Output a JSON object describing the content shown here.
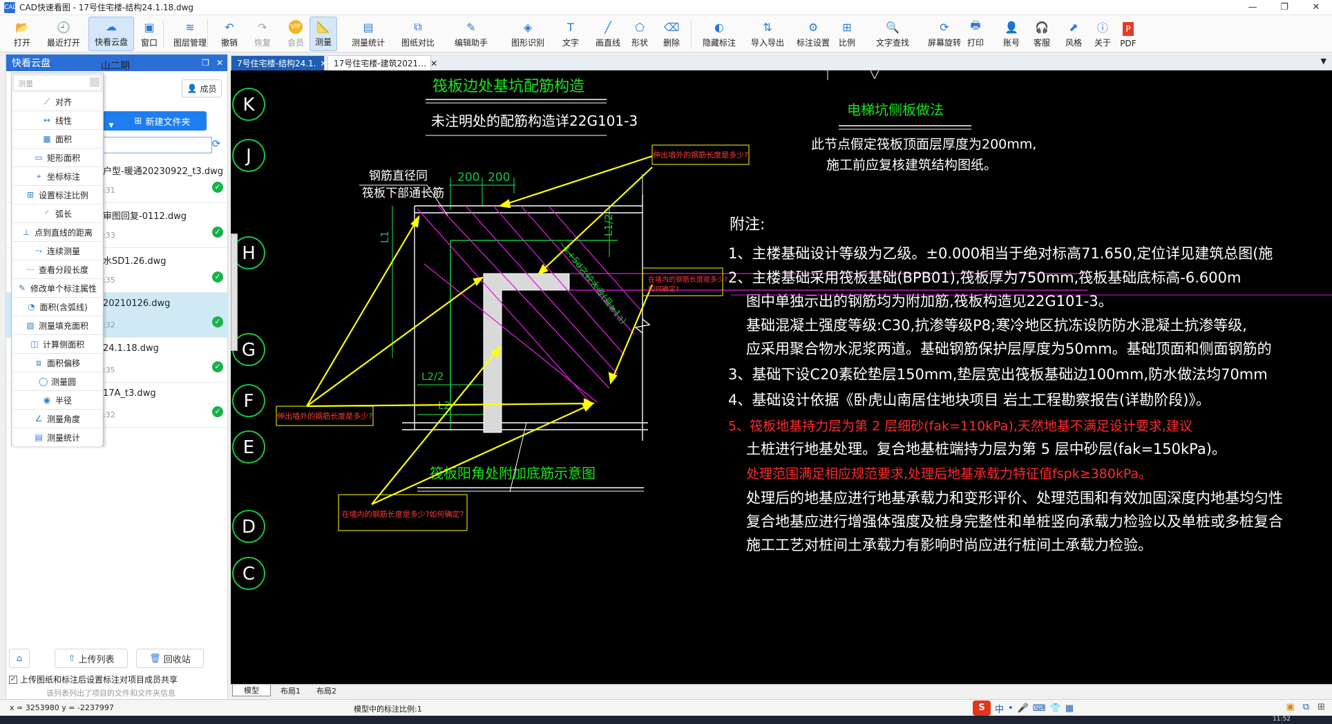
{
  "window": {
    "app_icon": "CAD",
    "title": "CAD快速看图 - 17号住宅楼-结构24.1.18.dwg",
    "controls": [
      "—",
      "❐",
      "✕"
    ]
  },
  "toolbar": {
    "buttons": [
      {
        "label": "打开",
        "icon": "open-folder-icon",
        "glyph": "📂"
      },
      {
        "label": "最近打开",
        "icon": "clock-icon",
        "glyph": "🕘"
      },
      {
        "label": "快看云盘",
        "icon": "cloud-icon",
        "glyph": "☁"
      },
      {
        "label": "窗口",
        "icon": "window-icon",
        "glyph": "▣"
      },
      {
        "label": "图层管理",
        "icon": "layers-icon",
        "glyph": "≋"
      },
      {
        "label": "撤销",
        "icon": "undo-icon",
        "glyph": "↶"
      },
      {
        "label": "恢复",
        "icon": "redo-icon",
        "glyph": "↷"
      },
      {
        "label": "会员",
        "icon": "vip-icon",
        "glyph": "VIP"
      },
      {
        "label": "测量",
        "icon": "measure-icon",
        "glyph": "📐"
      },
      {
        "label": "测量统计",
        "icon": "measure-stats-icon",
        "glyph": "▤"
      },
      {
        "label": "图纸对比",
        "icon": "compare-icon",
        "glyph": "⧉"
      },
      {
        "label": "编辑助手",
        "icon": "edit-helper-icon",
        "glyph": "✎"
      },
      {
        "label": "图形识别",
        "icon": "shape-recognition-icon",
        "glyph": "◈"
      },
      {
        "label": "文字",
        "icon": "text-icon",
        "glyph": "T"
      },
      {
        "label": "画直线",
        "icon": "line-icon",
        "glyph": "╱"
      },
      {
        "label": "形状",
        "icon": "shape-icon",
        "glyph": "⬠"
      },
      {
        "label": "删除",
        "icon": "eraser-icon",
        "glyph": "⌫"
      },
      {
        "label": "隐藏标注",
        "icon": "hide-annotation-icon",
        "glyph": "◐"
      },
      {
        "label": "导入导出",
        "icon": "import-export-icon",
        "glyph": "⇅"
      },
      {
        "label": "标注设置",
        "icon": "annotation-settings-icon",
        "glyph": "⚙"
      },
      {
        "label": "比例",
        "icon": "scale-icon",
        "glyph": "⊞"
      },
      {
        "label": "文字查找",
        "icon": "text-search-icon",
        "glyph": "🔍"
      },
      {
        "label": "屏幕旋转",
        "icon": "rotate-screen-icon",
        "glyph": "⟳"
      },
      {
        "label": "打印",
        "icon": "print-icon",
        "glyph": "🖶"
      },
      {
        "label": "账号",
        "icon": "account-icon",
        "glyph": "👤"
      },
      {
        "label": "客服",
        "icon": "headset-icon",
        "glyph": "🎧"
      },
      {
        "label": "风格",
        "icon": "style-icon",
        "glyph": "⬈"
      },
      {
        "label": "关于",
        "icon": "about-icon",
        "glyph": "ⓘ"
      },
      {
        "label": "PDF",
        "icon": "pdf-icon",
        "glyph": "P"
      }
    ]
  },
  "sidebar": {
    "title": "快看云盘",
    "project": "山二期",
    "member_label": "成员",
    "new_folder_label": "新建文件夹",
    "files": [
      {
        "name": "户型-暖通20230922_t3.dwg",
        "time": ":31",
        "selected": false
      },
      {
        "name": "审图回复-0112.dwg",
        "time": ":33",
        "selected": false
      },
      {
        "name": "水SD1.26.dwg",
        "time": ":35",
        "selected": false
      },
      {
        "name": "20210126.dwg",
        "time": ":32",
        "selected": true
      },
      {
        "name": "24.1.18.dwg",
        "time": ":35",
        "selected": false
      },
      {
        "name": "17A_t3.dwg",
        "time": ":32",
        "selected": false
      }
    ],
    "upload_list_label": "上传列表",
    "recycle_label": "回收站",
    "share_checkbox_label": "上传图纸和标注后设置标注对项目成员共享",
    "note": "该列表列出了项目的文件和文件夹信息"
  },
  "measure_menu": {
    "search_placeholder": "测量",
    "items": [
      {
        "label": "对齐",
        "icon": "align-measure-icon",
        "glyph": "⟋"
      },
      {
        "label": "线性",
        "icon": "linear-measure-icon",
        "glyph": "↔"
      },
      {
        "label": "面积",
        "icon": "area-icon",
        "glyph": "▦"
      },
      {
        "label": "矩形面积",
        "icon": "rect-area-icon",
        "glyph": "▭"
      },
      {
        "label": "坐标标注",
        "icon": "coordinate-icon",
        "glyph": "⌖"
      },
      {
        "label": "设置标注比例",
        "icon": "set-scale-icon",
        "glyph": "⊞"
      },
      {
        "label": "弧长",
        "icon": "arc-length-icon",
        "glyph": "◜"
      },
      {
        "label": "点到直线的距离",
        "icon": "point-line-distance-icon",
        "glyph": "⊥"
      },
      {
        "label": "连续测量",
        "icon": "continuous-measure-icon",
        "glyph": "⤳"
      },
      {
        "label": "查看分段长度",
        "icon": "segment-length-icon",
        "glyph": "⋯"
      },
      {
        "label": "修改单个标注属性",
        "icon": "edit-annotation-icon",
        "glyph": "✎"
      },
      {
        "label": "面积(含弧线)",
        "icon": "arc-area-icon",
        "glyph": "◔"
      },
      {
        "label": "测量填充面积",
        "icon": "fill-area-icon",
        "glyph": "▨"
      },
      {
        "label": "计算侧面积",
        "icon": "side-area-icon",
        "glyph": "◫"
      },
      {
        "label": "面积偏移",
        "icon": "area-offset-icon",
        "glyph": "⧈"
      },
      {
        "label": "测量圆",
        "icon": "circle-measure-icon",
        "glyph": "◯"
      },
      {
        "label": "半径",
        "icon": "radius-icon",
        "glyph": "◉"
      },
      {
        "label": "测量角度",
        "icon": "angle-icon",
        "glyph": "∠"
      },
      {
        "label": "测量统计",
        "icon": "measure-stats-icon",
        "glyph": "▤"
      }
    ]
  },
  "doc_tabs": [
    {
      "label": "7号住宅楼-结构24.1.",
      "active": true
    },
    {
      "label": "17号住宅楼-建筑2021…",
      "active": false
    }
  ],
  "drawing": {
    "axis_labels": [
      "K",
      "J",
      "H",
      "G",
      "F",
      "E",
      "D",
      "C"
    ],
    "title1": "筏板边处基坑配筋构造",
    "subtitle1": "未注明处的配筋构造详22G101-3",
    "title2": "筏板阳角处附加底筋示意图",
    "title3": "电梯坑侧板做法",
    "note3_line1": "此节点假定筏板顶面层厚度为200mm,",
    "note3_line2": "施工前应复核建筑结构图纸。",
    "rebar_label_line1": "钢筋直径同",
    "rebar_label_line2": "筏板下部通长筋",
    "dims": [
      "200",
      "200",
      "L1",
      "L1/2",
      "L2/2",
      "L2",
      "L+5d之较大者(且≥1a)"
    ],
    "questions": [
      "伸出墙外的钢筋长度是多少?",
      "在墙内的钢筋长度是多少?如何确定?",
      "伸出墙外的钢筋长度是多少?",
      "在墙内的钢筋长度是多少?如何确定?"
    ],
    "notes_header": "附注:",
    "notes": [
      {
        "text": "1、主楼基础设计等级为乙级。±0.000相当于绝对标高71.650,定位详见建筑总图(施",
        "color": "#ffffff"
      },
      {
        "text": "2、主楼基础采用筏板基础(BPB01),筏板厚为750mm,筏板基础底标高-6.600m",
        "color": "#ffffff"
      },
      {
        "text": "图中单独示出的钢筋均为附加筋,筏板构造见22G101-3。",
        "color": "#ffffff"
      },
      {
        "text": "基础混凝土强度等级:C30,抗渗等级P8;寒冷地区抗冻设防防水混凝土抗渗等级,",
        "color": "#ffffff"
      },
      {
        "text": "应采用聚合物水泥浆两道。基础钢筋保护层厚度为50mm。基础顶面和侧面钢筋的",
        "color": "#ffffff"
      },
      {
        "text": "3、基础下设C20素砼垫层150mm,垫层宽出筏板基础边100mm,防水做法均70mm",
        "color": "#ffffff"
      },
      {
        "text": "4、基础设计依据《卧虎山南居住地块项目 岩土工程勘察报告(详勘阶段)》。",
        "color": "#ffffff"
      },
      {
        "text": "5、筏板地基持力层为第 2 层细砂(fak=110kPa),天然地基不满足设计要求,建议",
        "color": "#ff2a2a"
      },
      {
        "text": "土桩进行地基处理。复合地基桩端持力层为第 5 层中砂层(fak=150kPa)。",
        "color": "#ffffff"
      },
      {
        "text": "处理范围满足相应规范要求,处理后地基承载力特征值fspk≥380kPa。",
        "color": "#ff2a2a"
      },
      {
        "text": "处理后的地基应进行地基承载力和变形评价、处理范围和有效加固深度内地基均匀性",
        "color": "#ffffff"
      },
      {
        "text": "复合地基应进行增强体强度及桩身完整性和单桩竖向承载力检验以及单桩或多桩复合",
        "color": "#ffffff"
      },
      {
        "text": "施工工艺对桩间土承载力有影响时尚应进行桩间土承载力检验。",
        "color": "#ffffff"
      }
    ]
  },
  "layout_tabs": [
    "模型",
    "布局1",
    "布局2"
  ],
  "status": {
    "coords": "x = 3253980  y = -2237997",
    "scale_text": "模型中的标注比例:1",
    "ime_items": [
      "中",
      "•",
      "🎤",
      "⌨",
      "👕",
      "▦"
    ],
    "clock": "11:52"
  }
}
